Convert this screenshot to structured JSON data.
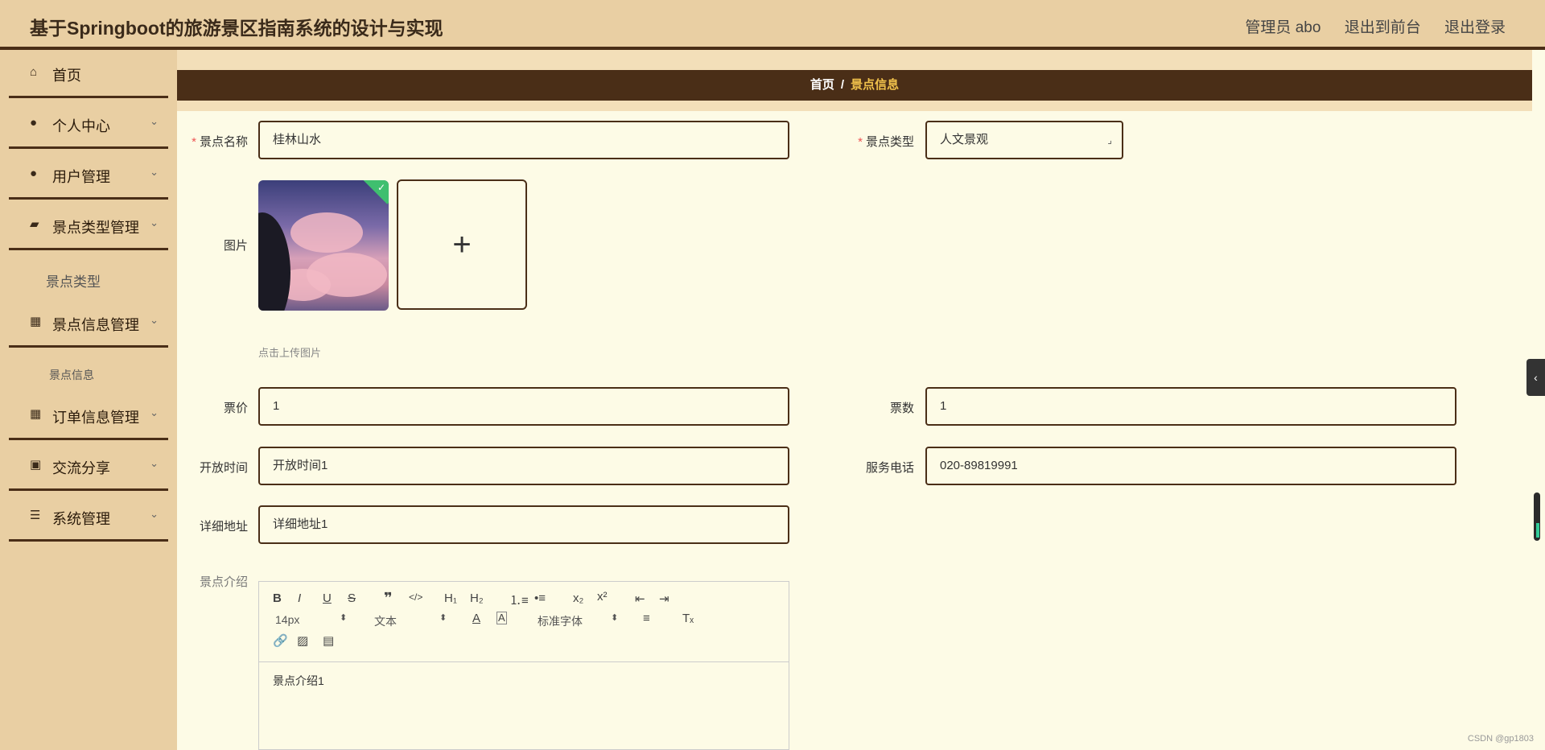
{
  "header": {
    "title": "基于Springboot的旅游景区指南系统的设计与实现",
    "user": "管理员 abo",
    "front": "退出到前台",
    "logout": "退出登录"
  },
  "sidebar": {
    "items": [
      {
        "label": "首页",
        "icon": "home-icon"
      },
      {
        "label": "个人中心",
        "icon": "user-icon"
      },
      {
        "label": "用户管理",
        "icon": "user-icon"
      },
      {
        "label": "景点类型管理",
        "icon": "wallet-icon"
      },
      {
        "label": "景点信息管理",
        "icon": "grid-icon"
      },
      {
        "label": "订单信息管理",
        "icon": "grid-icon"
      },
      {
        "label": "交流分享",
        "icon": "clipboard-icon"
      },
      {
        "label": "系统管理",
        "icon": "sliders-icon"
      }
    ],
    "sub_type": "景点类型",
    "sub_info": "景点信息"
  },
  "breadcrumb": {
    "home": "首页",
    "sep": "/",
    "current": "景点信息"
  },
  "form": {
    "name_label": "景点名称",
    "name_value": "桂林山水",
    "type_label": "景点类型",
    "type_value": "人文景观",
    "image_label": "图片",
    "upload_hint": "点击上传图片",
    "price_label": "票价",
    "price_value": "1",
    "count_label": "票数",
    "count_value": "1",
    "open_label": "开放时间",
    "open_value": "开放时间1",
    "phone_label": "服务电话",
    "phone_value": "020-89819991",
    "addr_label": "详细地址",
    "addr_value": "详细地址1",
    "intro_label": "景点介绍"
  },
  "editor": {
    "font_size": "14px",
    "block": "文本",
    "font": "标准字体",
    "content": "景点介绍1"
  },
  "watermark": "CSDN @gp1803"
}
